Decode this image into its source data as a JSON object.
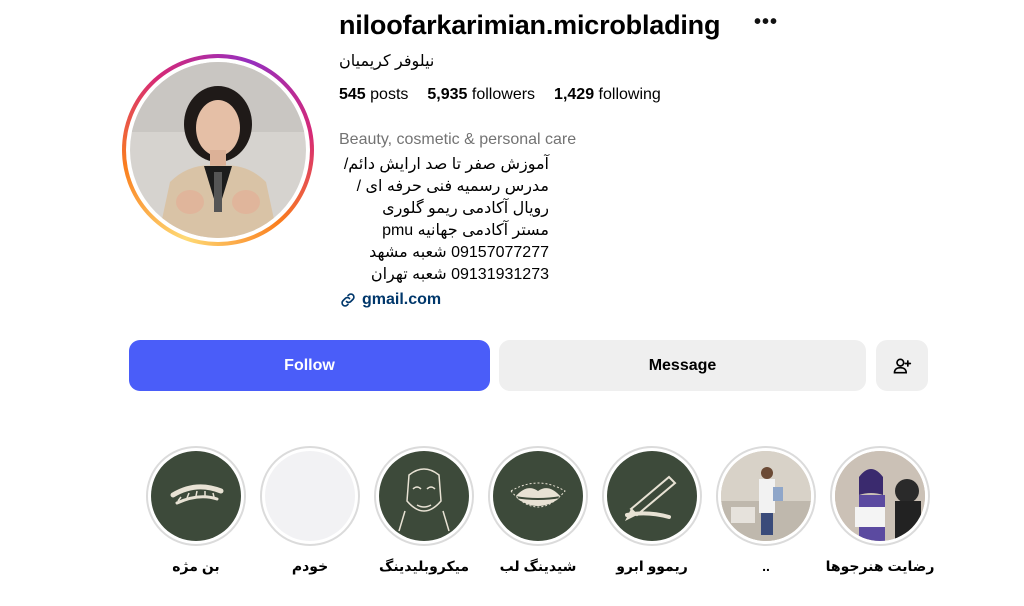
{
  "profile": {
    "username": "niloofarkarimian.microblading",
    "more_icon": "more-horizontal-icon",
    "full_name": "نیلوفر کریمیان",
    "stats": {
      "posts_count": "545",
      "posts_label": "posts",
      "followers_count": "5,935",
      "followers_label": "followers",
      "following_count": "1,429",
      "following_label": "following"
    },
    "category": "Beauty, cosmetic & personal care",
    "bio": [
      "آموزش صفر تا صد ارایش دائم/",
      "مدرس رسمیه فنی حرفه ای /",
      "رویال آکادمی ریمو گلوری",
      "مستر آکادمی جهانیه pmu",
      "09157077277 شعبه مشهد",
      "09131931273 شعبه تهران"
    ],
    "link": {
      "icon": "link-icon",
      "text": "gmail.com"
    }
  },
  "actions": {
    "follow_label": "Follow",
    "message_label": "Message",
    "add_user_icon": "person-add-icon"
  },
  "highlights": [
    {
      "label": "بن مژه",
      "icon": "eyelash-icon"
    },
    {
      "label": "خودم",
      "icon": "blank"
    },
    {
      "label": "میکروبلیدینگ",
      "icon": "face-icon"
    },
    {
      "label": "شیدینگ لب",
      "icon": "lips-icon"
    },
    {
      "label": "ریموو ابرو",
      "icon": "pen-tool-icon"
    },
    {
      "label": "..",
      "icon": "photo"
    },
    {
      "label": "رضایت هنرجوها",
      "icon": "photo"
    }
  ],
  "colors": {
    "follow_button": "#4a5df9",
    "secondary_button": "#efefef",
    "highlight_bg": "#3d4a3a",
    "link": "#00376b",
    "category": "#737373"
  }
}
